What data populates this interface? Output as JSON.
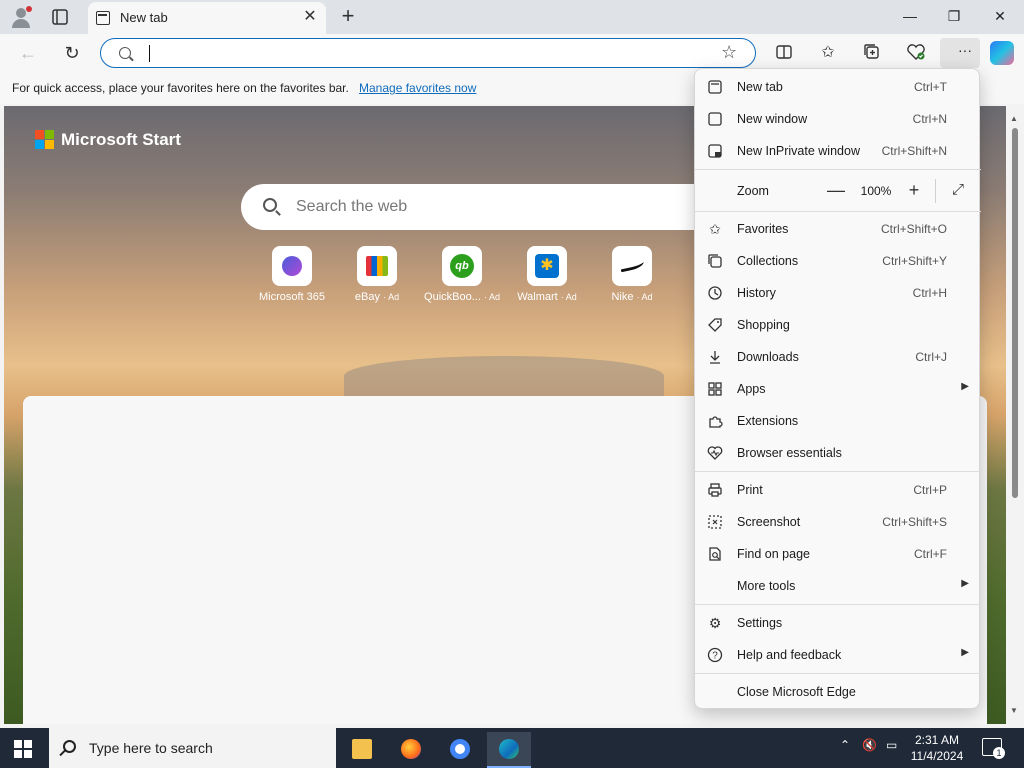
{
  "tab": {
    "title": "New tab",
    "close": "✕",
    "new": "+"
  },
  "window": {
    "minimize": "—",
    "restore": "❐",
    "close": "✕"
  },
  "toolbar": {
    "back": "←",
    "refresh": "↻",
    "address_value": "",
    "menu_dots": "···"
  },
  "favorites_bar": {
    "message": "For quick access, place your favorites here on the favorites bar.",
    "link": "Manage favorites now"
  },
  "content": {
    "brand": "Microsoft Start",
    "search_placeholder": "Search the web",
    "tiles": [
      {
        "label": "Microsoft 365",
        "ad": ""
      },
      {
        "label": "eBay",
        "ad": "· Ad"
      },
      {
        "label": "QuickBoo...",
        "ad": "· Ad"
      },
      {
        "label": "Walmart",
        "ad": "· Ad"
      },
      {
        "label": "Nike",
        "ad": "· Ad"
      }
    ],
    "qb_glyph": "qb",
    "walmart_glyph": "✱"
  },
  "menu": {
    "items": [
      {
        "label": "New tab",
        "shortcut": "Ctrl+T",
        "icon": "new-tab-icon"
      },
      {
        "label": "New window",
        "shortcut": "Ctrl+N",
        "icon": "new-window-icon"
      },
      {
        "label": "New InPrivate window",
        "shortcut": "Ctrl+Shift+N",
        "icon": "inprivate-icon"
      },
      {
        "label": "Favorites",
        "shortcut": "Ctrl+Shift+O",
        "icon": "favorites-icon"
      },
      {
        "label": "Collections",
        "shortcut": "Ctrl+Shift+Y",
        "icon": "collections-icon"
      },
      {
        "label": "History",
        "shortcut": "Ctrl+H",
        "icon": "history-icon"
      },
      {
        "label": "Shopping",
        "shortcut": "",
        "icon": "shopping-icon"
      },
      {
        "label": "Downloads",
        "shortcut": "Ctrl+J",
        "icon": "downloads-icon"
      },
      {
        "label": "Apps",
        "shortcut": "",
        "icon": "apps-icon"
      },
      {
        "label": "Extensions",
        "shortcut": "",
        "icon": "extensions-icon"
      },
      {
        "label": "Browser essentials",
        "shortcut": "",
        "icon": "browser-essentials-icon"
      },
      {
        "label": "Print",
        "shortcut": "Ctrl+P",
        "icon": "print-icon"
      },
      {
        "label": "Screenshot",
        "shortcut": "Ctrl+Shift+S",
        "icon": "screenshot-icon"
      },
      {
        "label": "Find on page",
        "shortcut": "Ctrl+F",
        "icon": "find-icon"
      },
      {
        "label": "More tools",
        "shortcut": "",
        "icon": ""
      },
      {
        "label": "Settings",
        "shortcut": "",
        "icon": "settings-icon"
      },
      {
        "label": "Help and feedback",
        "shortcut": "",
        "icon": "help-icon"
      },
      {
        "label": "Close Microsoft Edge",
        "shortcut": "",
        "icon": ""
      }
    ],
    "zoom": {
      "label": "Zoom",
      "value": "100%",
      "minus": "—",
      "plus": "+"
    }
  },
  "taskbar": {
    "search_text": "Type here to search",
    "time": "2:31 AM",
    "date": "11/4/2024",
    "notification_count": "1"
  },
  "colors": {
    "accent": "#0f6cbd",
    "taskbar": "#1f2937"
  }
}
